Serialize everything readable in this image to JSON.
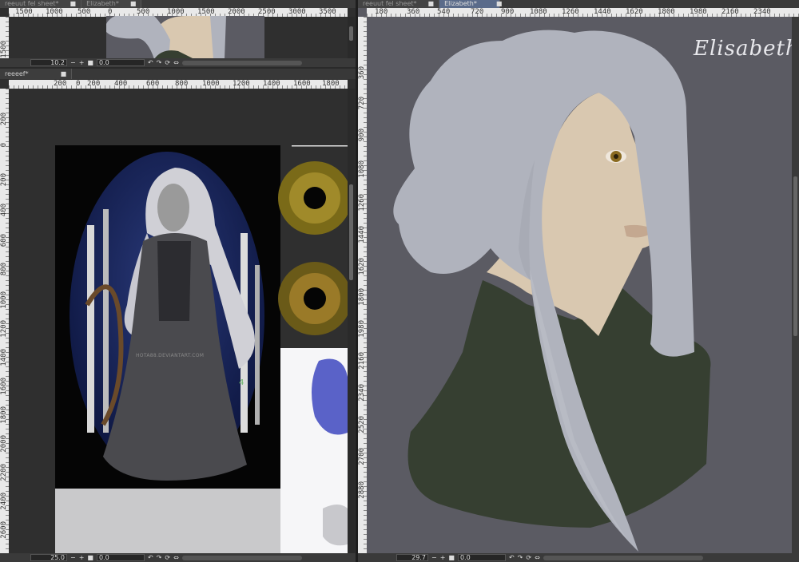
{
  "colors": {
    "canvas_bg": "#5b5b63",
    "hair": "#b0b3bd",
    "skin": "#d9c8b0",
    "coat": "#363f31",
    "iris": "#8a6a20"
  },
  "top_left": {
    "tabs": [
      "reeuut fel sheet*",
      "Elizabeth*"
    ],
    "ruler_ticks": [
      "1500",
      "1000",
      "500",
      "0",
      "500",
      "1000",
      "1500",
      "2000",
      "2500",
      "3000",
      "3500"
    ],
    "vruler_ticks": [
      "1500"
    ],
    "zoom": "10.2",
    "angle": "0.0"
  },
  "bottom_left": {
    "tabs": [
      "reeeef*"
    ],
    "ruler_ticks": [
      "200",
      "0",
      "200",
      "400",
      "600",
      "800",
      "1000",
      "1200",
      "1400",
      "1600",
      "1800"
    ],
    "vruler_ticks": [
      "200",
      "0",
      "200",
      "400",
      "600",
      "800",
      "1000",
      "1200",
      "1400",
      "1600",
      "1800",
      "2000",
      "2200",
      "2400",
      "2600"
    ],
    "zoom": "25.0",
    "angle": "0.0",
    "watermark": "HOTA88.DEVIANTART.COM",
    "signature": "4"
  },
  "right": {
    "tabs": [
      "reeuut fel sheet*",
      "Elizabeth*"
    ],
    "ruler_ticks": [
      "180",
      "360",
      "540",
      "720",
      "900",
      "1080",
      "1260",
      "1440",
      "1620",
      "1800",
      "1980",
      "2160",
      "2340"
    ],
    "vruler_ticks": [
      "180",
      "360",
      "540",
      "720",
      "900",
      "1080",
      "1260",
      "1440",
      "1620",
      "1800",
      "1980",
      "2160",
      "2340",
      "2520",
      "2700",
      "2880",
      "360"
    ],
    "title": "Elisabeth",
    "zoom": "29.7",
    "angle": "0.0"
  },
  "controls": {
    "minus": "−",
    "plus": "+",
    "reset": "■",
    "rotate_left": "↶",
    "rotate_right": "↷",
    "reset_rotate": "⟳",
    "mirror": "⇔"
  }
}
